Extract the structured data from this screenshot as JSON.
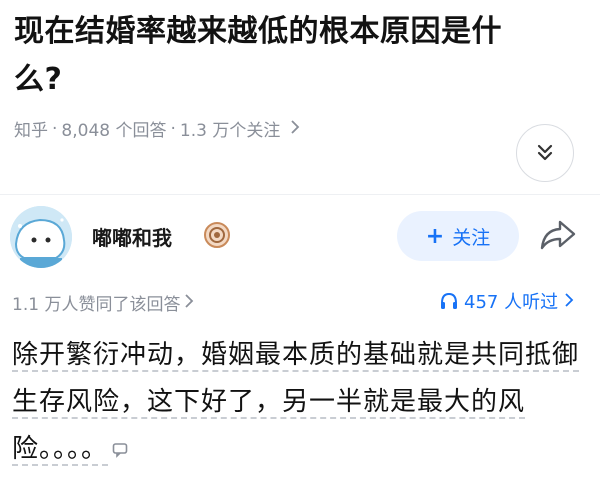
{
  "question": {
    "title": "现在结婚率越来越低的根本原因是什么?",
    "source": "知乎",
    "answers_count": "8,048 个回答",
    "followers_count": "1.3 万个关注"
  },
  "author": {
    "name": "嘟嘟和我",
    "follow_label": "关注"
  },
  "stats": {
    "likes": "1.1 万人赞同了该回答",
    "listens": "457 人听过"
  },
  "answer": {
    "text": "除开繁衍冲动，婚姻最本质的基础就是共同抵御生存风险，这下好了，另一半就是最大的风险。。。。"
  },
  "colors": {
    "accent": "#1772f6",
    "muted": "#8a8f99",
    "follow_bg": "#eaf2ff"
  },
  "icons": [
    "chevron-right-icon",
    "double-chevron-down-icon",
    "avatar-icon",
    "badge-icon",
    "share-icon",
    "headphones-icon",
    "comment-icon"
  ]
}
